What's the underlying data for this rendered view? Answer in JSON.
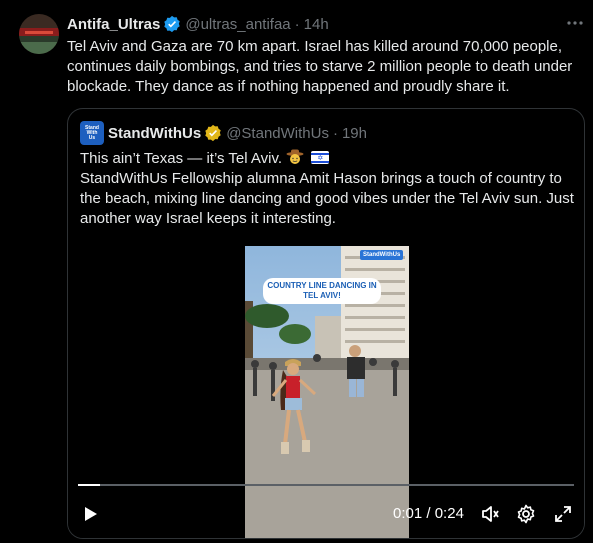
{
  "tweet": {
    "display_name": "Antifa_Ultras",
    "handle": "@ultras_antifaa",
    "separator": "·",
    "time": "14h",
    "text": "Tel Aviv and Gaza are 70 km apart. Israel has killed around 70,000 people, continues daily bombings, and tries to starve 2 million people to death under blockade. They dance as if nothing happened and proudly share it."
  },
  "quoted": {
    "avatar_text": [
      "Stand",
      "With",
      "Us"
    ],
    "display_name": "StandWithUs",
    "handle": "@StandWithUs",
    "separator": "·",
    "time": "19h",
    "line1": "This ain’t Texas — it’s Tel Aviv.",
    "line2": "StandWithUs Fellowship alumna Amit Hason brings a touch of country to the beach, mixing line dancing and good vibes under the Tel Aviv sun. Just another way Israel keeps it interesting."
  },
  "video": {
    "overlay_label": "COUNTRY LINE DANCING IN TEL AVIV!",
    "brand_tag": "StandWithUs",
    "current_time": "0:01",
    "duration": "0:24",
    "time_separator": " / ",
    "progress_fraction": 0.045
  },
  "colors": {
    "verified_blue": "#1d9bf0",
    "verified_gold": "#e2b719",
    "muted_text": "#71767b",
    "border": "#2f3336"
  },
  "icons": [
    "verified-badge-icon",
    "gold-verified-badge-icon",
    "more-icon",
    "play-icon",
    "volume-icon",
    "settings-icon",
    "fullscreen-icon",
    "cowboy-face-emoji",
    "israel-flag-emoji"
  ]
}
